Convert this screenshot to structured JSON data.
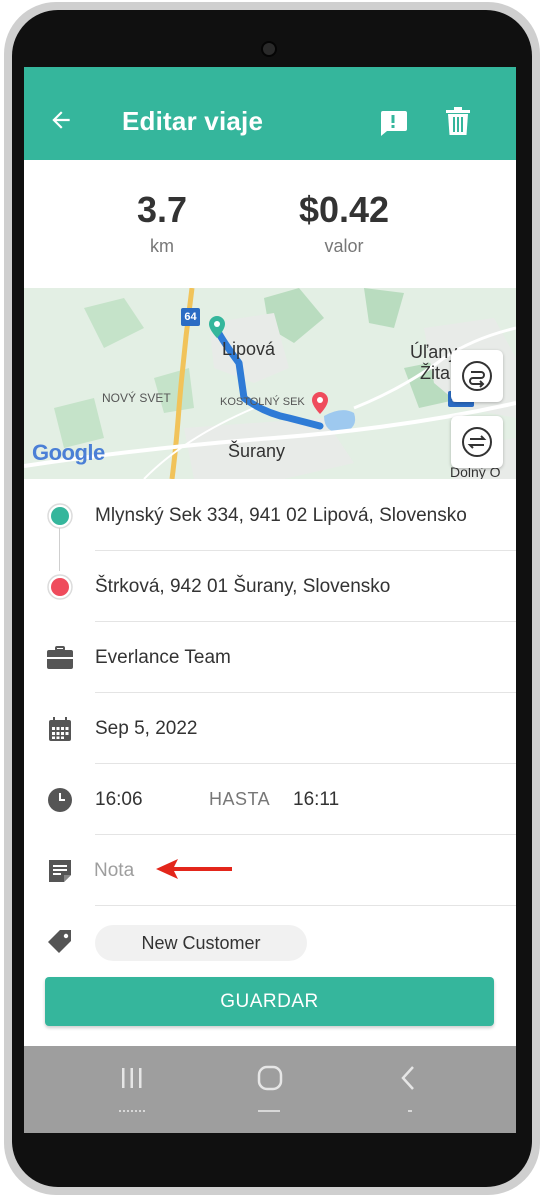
{
  "appbar": {
    "title": "Editar viaje",
    "icons": [
      "arrow-left-icon",
      "report-icon",
      "trash-icon"
    ]
  },
  "stats": {
    "distance_value": "3.7",
    "distance_unit": "km",
    "amount_value": "$0.42",
    "amount_label": "valor"
  },
  "map": {
    "road_badge": "64",
    "road_badge_2": "580",
    "labels": {
      "lipova": "Lipová",
      "novy_svet": "NOVÝ SVET",
      "kostolny_sek": "KOSTOLNÝ SEK",
      "surany": "Šurany",
      "ulany": "Úľany",
      "zitav": "Žita",
      "dolny": "Dolný O"
    },
    "attribution": "Google"
  },
  "trip": {
    "start_address": "Mlynský Sek 334, 941 02 Lipová, Slovensko",
    "end_address": "Štrková, 942 01 Šurany, Slovensko",
    "team": "Everlance Team",
    "date": "Sep 5, 2022",
    "start_time": "16:06",
    "until_label": "HASTA",
    "end_time": "16:11",
    "note_placeholder": "Nota",
    "tag": "New Customer"
  },
  "actions": {
    "save_label": "GUARDAR"
  },
  "colors": {
    "primary": "#35b69c",
    "start_dot": "#35b69c",
    "end_dot": "#ef4b5c",
    "annotation_arrow": "#e3261b"
  }
}
